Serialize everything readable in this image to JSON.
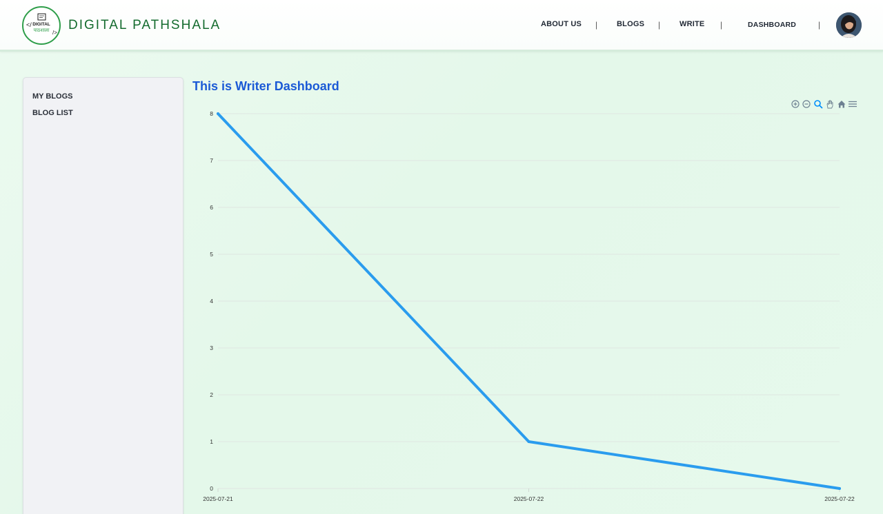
{
  "header": {
    "brand": "DIGITAL PATHSHALA",
    "logo_text_top": "DIGITAL",
    "logo_text_bottom": "पाठशाला",
    "nav": [
      {
        "label": "ABOUT US"
      },
      {
        "label": "BLOGS"
      },
      {
        "label": "WRITE"
      },
      {
        "label": "DASHBOARD"
      }
    ],
    "separator": "|"
  },
  "sidebar": {
    "items": [
      {
        "label": "MY BLOGS"
      },
      {
        "label": "BLOG LIST"
      }
    ]
  },
  "main": {
    "title": "This is Writer Dashboard",
    "toolbar_icons": [
      "zoom-in-icon",
      "zoom-out-icon",
      "selection-zoom-icon",
      "pan-hand-icon",
      "reset-home-icon",
      "menu-icon"
    ]
  },
  "colors": {
    "brand_green": "#146b2e",
    "title_blue": "#1b5ad6",
    "series_blue": "#2a9cee"
  },
  "chart_data": {
    "type": "line",
    "x": [
      "2025-07-21",
      "2025-07-22",
      "2025-07-22"
    ],
    "series": [
      {
        "values": [
          8,
          1,
          0
        ]
      }
    ],
    "ylim": [
      0,
      8
    ],
    "yticks": [
      0,
      1,
      2,
      3,
      4,
      5,
      6,
      7,
      8
    ],
    "grid": true,
    "title": "",
    "xlabel": "",
    "ylabel": ""
  }
}
